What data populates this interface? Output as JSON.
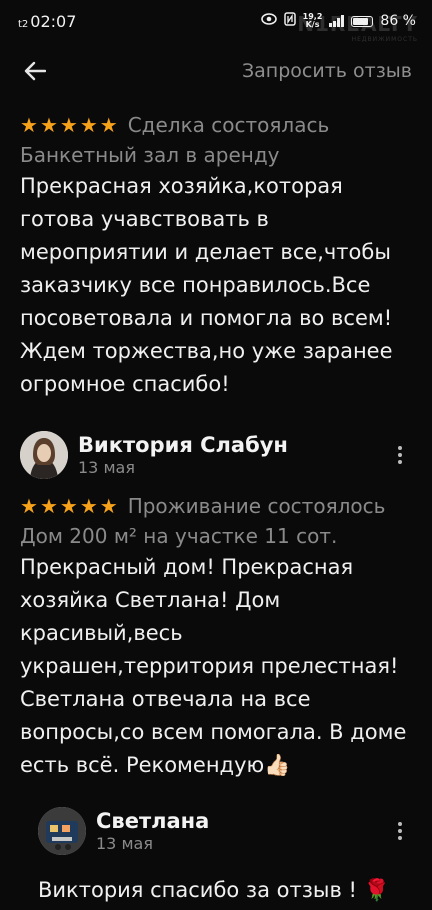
{
  "status_bar": {
    "carrier": "t2",
    "time": "02:07",
    "speed_value": "19,2",
    "speed_unit": "K/s",
    "network": "4G",
    "battery": "86 %",
    "watermark": "N1REALTY",
    "watermark_sub": "НЕДВИЖИМОСТЬ"
  },
  "app_bar": {
    "back_icon": "arrow-left-icon",
    "request_review": "Запросить отзыв"
  },
  "reviews": [
    {
      "rating": 5,
      "status": "Сделка состоялась",
      "listing": "Банкетный зал в аренду",
      "text": "Прекрасная хозяйка,которая\nготова учавствовать в\nмероприятии и делает все,чтобы\nзаказчику все понравилось.Все\nпосоветовала и помогла во всем!\nЖдем торжества,но уже заранее\nогромное спасибо!"
    },
    {
      "author": "Виктория Слабун",
      "date": "13 мая",
      "rating": 5,
      "status": "Проживание состоялось",
      "listing": "Дом 200 м² на участке 11 сот.",
      "text": "Прекрасный дом! Прекрасная\nхозяйка Светлана! Дом\nкрасивый,весь\nукрашен,территория прелестная!\nСветлана отвечала на все\nвопросы,со всем помогала. В доме\nесть всё. Рекомендую👍🏻",
      "reply": {
        "author": "Светлана",
        "date": "13 мая",
        "text": "Виктория спасибо за отзыв ! 🌹"
      }
    }
  ],
  "colors": {
    "background": "#0a0a0a",
    "star": "#f7a21b",
    "muted": "#8a8a8a"
  }
}
